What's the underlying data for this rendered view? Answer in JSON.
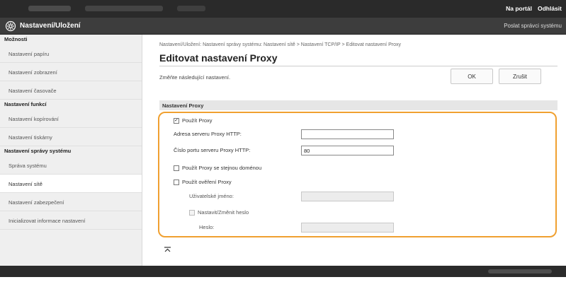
{
  "topbar": {
    "portal_link": "Na portál",
    "logout_link": "Odhlásit"
  },
  "header": {
    "title": "Nastavení/Uložení",
    "right_text": "Poslat správci systému"
  },
  "sidebar": {
    "groups": [
      {
        "heading": "Možnosti",
        "items": [
          "Nastavení papíru",
          "Nastavení zobrazení",
          "Nastavení časovače"
        ]
      },
      {
        "heading": "Nastavení funkcí",
        "items": [
          "Nastavení kopírování",
          "Nastavení tiskárny"
        ]
      },
      {
        "heading": "Nastavení správy systému",
        "items": [
          "Správa systému",
          "Nastavení sítě",
          "Nastavení zabezpečení",
          "Inicializovat informace nastavení"
        ]
      }
    ],
    "active_item": "Nastavení sítě"
  },
  "main": {
    "breadcrumb": "Nastavení/Uložení: Nastavení správy systému: Nastavení sítě > Nastavení TCP/IP > Editovat nastavení Proxy",
    "title": "Editovat nastavení Proxy",
    "instruction": "Změňte následující nastavení.",
    "ok_label": "OK",
    "cancel_label": "Zrušit",
    "section_title": "Nastavení Proxy"
  },
  "form": {
    "use_proxy": {
      "label": "Použít Proxy",
      "checked": true
    },
    "http_proxy_address": {
      "label": "Adresa serveru Proxy HTTP:",
      "value": ""
    },
    "http_proxy_port": {
      "label": "Číslo portu serveru Proxy HTTP:",
      "value": "80"
    },
    "same_domain": {
      "label": "Použít Proxy se stejnou doménou",
      "checked": false
    },
    "proxy_auth": {
      "label": "Použít ověření Proxy",
      "checked": false
    },
    "username": {
      "label": "Uživatelské jméno:",
      "value": ""
    },
    "set_change_password": {
      "label": "Nastavit/Změnit heslo",
      "checked": false
    },
    "password": {
      "label": "Heslo:",
      "value": ""
    }
  },
  "colors": {
    "highlight": "#f0a030",
    "topbar": "#2a2a2a",
    "header": "#3d3d3d"
  }
}
